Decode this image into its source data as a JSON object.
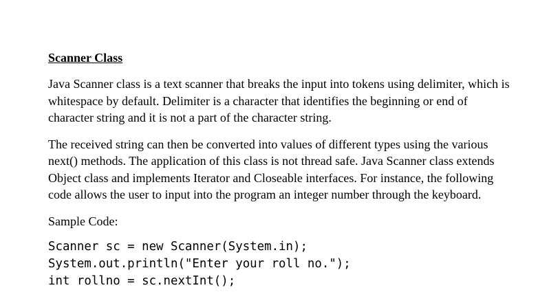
{
  "document": {
    "heading": "Scanner Class",
    "paragraph1": [
      "Java Scanner class is a text scanner that breaks the input into tokens using delimiter, which is",
      "whitespace by default. Delimiter is a character that identifies the beginning or end of",
      "character string and it is not a part of the character string."
    ],
    "paragraph2": [
      "The received string can then be converted into values of different types using the various",
      "next() methods. The application of this class is not thread safe. Java Scanner class extends",
      "Object class and implements Iterator and Closeable interfaces. For instance, the following",
      "code allows the user to input into the program an integer number through the keyboard."
    ],
    "sample_label": "Sample Code:",
    "code_lines": [
      "Scanner sc = new Scanner(System.in);",
      "System.out.println(\"Enter your roll no.\");",
      "int rollno = sc.nextInt();"
    ]
  }
}
